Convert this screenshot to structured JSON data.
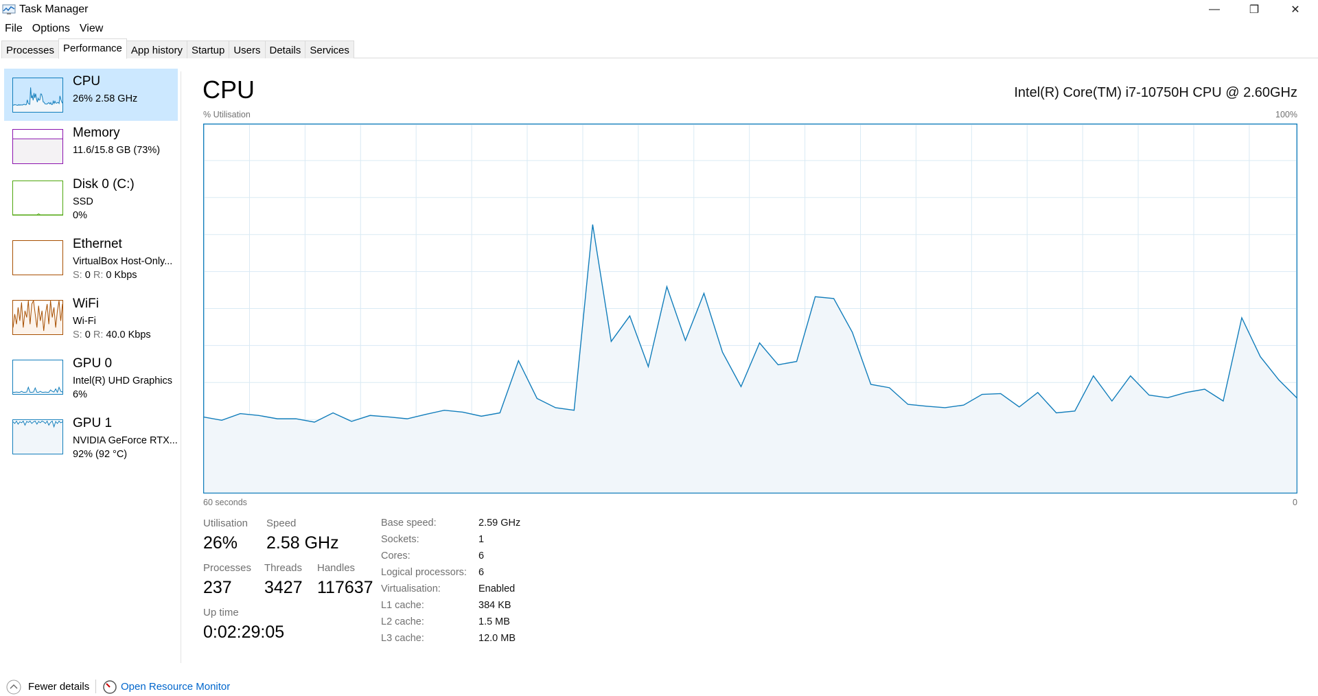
{
  "window": {
    "title": "Task Manager",
    "minimize": "—",
    "maximize": "❐",
    "close": "✕"
  },
  "menu": [
    "File",
    "Options",
    "View"
  ],
  "tabs": [
    "Processes",
    "Performance",
    "App history",
    "Startup",
    "Users",
    "Details",
    "Services"
  ],
  "sidebar": [
    {
      "title": "CPU",
      "line1": "26%  2.58 GHz",
      "color": "#117dbb"
    },
    {
      "title": "Memory",
      "line1": "11.6/15.8 GB (73%)",
      "color": "#8b12ae"
    },
    {
      "title": "Disk 0 (C:)",
      "line1": "SSD",
      "line2": "0%",
      "color": "#4da60c"
    },
    {
      "title": "Ethernet",
      "line1": "VirtualBox Host-Only...",
      "s_label": "S:",
      "s_val": "0",
      "r_label": "R:",
      "r_val": "0 Kbps",
      "color": "#a74f01"
    },
    {
      "title": "WiFi",
      "line1": "Wi-Fi",
      "s_label": "S:",
      "s_val": "0",
      "r_label": "R:",
      "r_val": "40.0 Kbps",
      "color": "#a74f01"
    },
    {
      "title": "GPU 0",
      "line1": "Intel(R) UHD Graphics",
      "line2": "6%",
      "color": "#117dbb"
    },
    {
      "title": "GPU 1",
      "line1": "NVIDIA GeForce RTX...",
      "line2": "92%  (92 °C)",
      "color": "#117dbb"
    }
  ],
  "main": {
    "title": "CPU",
    "model": "Intel(R) Core(TM) i7-10750H CPU @ 2.60GHz",
    "stats": {
      "utilisation_label": "Utilisation",
      "utilisation": "26%",
      "speed_label": "Speed",
      "speed": "2.58 GHz",
      "processes_label": "Processes",
      "processes": "237",
      "threads_label": "Threads",
      "threads": "3427",
      "handles_label": "Handles",
      "handles": "117637",
      "uptime_label": "Up time",
      "uptime": "0:02:29:05"
    },
    "details": [
      {
        "label": "Base speed:",
        "value": "2.59 GHz"
      },
      {
        "label": "Sockets:",
        "value": "1"
      },
      {
        "label": "Cores:",
        "value": "6"
      },
      {
        "label": "Logical processors:",
        "value": "6"
      },
      {
        "label": "Virtualisation:",
        "value": "Enabled"
      },
      {
        "label": "L1 cache:",
        "value": "384 KB"
      },
      {
        "label": "L2 cache:",
        "value": "1.5 MB"
      },
      {
        "label": "L3 cache:",
        "value": "12.0 MB"
      }
    ]
  },
  "chart_data": {
    "type": "area",
    "ylabel": "% Utilisation",
    "ymax_label": "100%",
    "xlabel_left": "60 seconds",
    "xlabel_right": "0",
    "ylim": [
      0,
      100
    ],
    "xlim": [
      60,
      0
    ],
    "grid": true,
    "color": "#117dbb",
    "fill": "#f1f6fa",
    "values": [
      20.7,
      19.8,
      21.6,
      21.1,
      20.2,
      20.2,
      19.3,
      21.8,
      19.5,
      21.1,
      20.7,
      20.2,
      21.4,
      22.5,
      22.0,
      20.9,
      21.8,
      35.9,
      25.7,
      23.2,
      22.5,
      72.7,
      41.1,
      48.0,
      34.3,
      55.9,
      41.4,
      54.1,
      38.2,
      28.9,
      40.7,
      34.8,
      35.7,
      53.2,
      52.7,
      43.6,
      29.5,
      28.6,
      24.1,
      23.6,
      23.2,
      23.9,
      26.8,
      27.0,
      23.4,
      27.3,
      21.8,
      22.3,
      31.8,
      25.0,
      31.8,
      26.6,
      25.9,
      27.3,
      28.2,
      25.0,
      47.5,
      37.0,
      30.7,
      25.7
    ]
  },
  "footer": {
    "fewer_details": "Fewer details",
    "resource_monitor": "Open Resource Monitor"
  }
}
